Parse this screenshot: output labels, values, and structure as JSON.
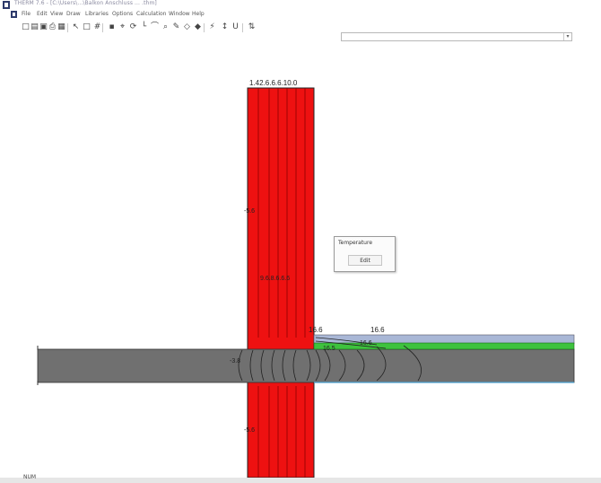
{
  "window": {
    "title": "THERM 7.6 - [C:\\Users\\...\\Balkon Anschluss ... .thm]"
  },
  "menu": [
    "File",
    "Edit",
    "View",
    "Draw",
    "Libraries",
    "Options",
    "Calculation",
    "Window",
    "Help"
  ],
  "toolbar": {
    "buttons": [
      {
        "name": "new-file-icon",
        "glyph": "□"
      },
      {
        "name": "open-file-icon",
        "glyph": "▤"
      },
      {
        "name": "save-icon",
        "glyph": "▣"
      },
      {
        "name": "print-icon",
        "glyph": "⎙"
      },
      {
        "name": "properties-icon",
        "glyph": "▦"
      },
      {
        "name": "select-icon",
        "glyph": "↖"
      },
      {
        "name": "rectangle-icon",
        "glyph": "□"
      },
      {
        "name": "grid-icon",
        "glyph": "#"
      },
      {
        "name": "point-icon",
        "glyph": "▪"
      },
      {
        "name": "locator-icon",
        "glyph": "⌖"
      },
      {
        "name": "rotate-icon",
        "glyph": "⟳"
      },
      {
        "name": "angle-icon",
        "glyph": "└"
      },
      {
        "name": "arc-icon",
        "glyph": "⌒"
      },
      {
        "name": "zoom-icon",
        "glyph": "⌕"
      },
      {
        "name": "pencil-icon",
        "glyph": "✎"
      },
      {
        "name": "diamond-icon",
        "glyph": "◇"
      },
      {
        "name": "fill-icon",
        "glyph": "◆"
      },
      {
        "name": "calculate-icon",
        "glyph": "⚡"
      },
      {
        "name": "boundary-icon",
        "glyph": "↕"
      },
      {
        "name": "u-factor-icon",
        "glyph": "U"
      },
      {
        "name": "results-icon",
        "glyph": "⇅"
      }
    ],
    "input_value": ""
  },
  "popup": {
    "title": "Temperature",
    "button": "Edit"
  },
  "labels": {
    "top": "1.42.6.6.6.10.0",
    "mid_wall": "9.6.8.6.6.6",
    "left_upper": "-5.6",
    "left_mid": "-3.8",
    "left_lower": "-5.6",
    "balcony_1": "16.6",
    "balcony_2": "16.6",
    "balcony_3": "16.5",
    "balcony_4": "16.6"
  },
  "colors": {
    "wall": "#ee1111",
    "slab": "#707070",
    "insulation_top": "#3ec23e",
    "finish_top": "#a9b7d6",
    "isotherm": "#2a2a2a"
  },
  "status": {
    "text": "NUM"
  }
}
